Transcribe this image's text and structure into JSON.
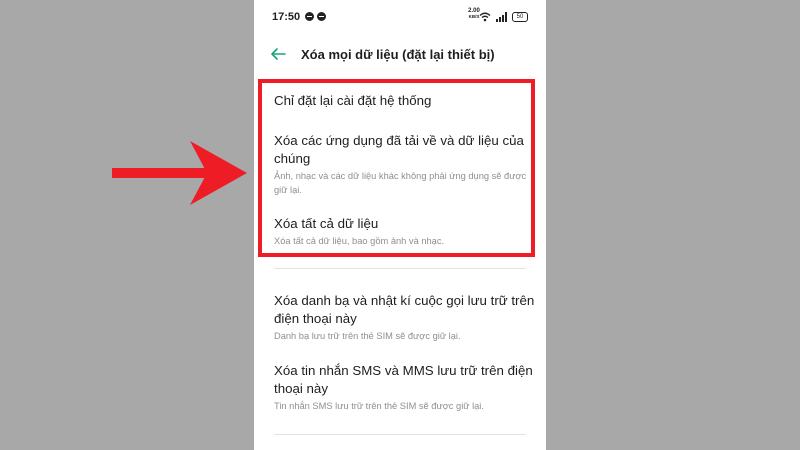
{
  "status_bar": {
    "time": "17:50",
    "net_speed": "2.00",
    "net_unit": "KB/S",
    "battery": "50",
    "icons": [
      "message-icon",
      "chat-icon",
      "wifi-icon",
      "signal-icon",
      "battery-icon"
    ]
  },
  "header": {
    "back_icon": "back-arrow-icon",
    "title": "Xóa mọi dữ liệu (đặt lại thiết bị)"
  },
  "options": [
    {
      "title": "Chỉ đặt lại cài đặt hệ thống",
      "description": ""
    },
    {
      "title": "Xóa các ứng dụng đã tải về và dữ liệu của chúng",
      "description": "Ảnh, nhạc và các dữ liệu khác không phải ứng dụng sẽ được giữ lại."
    },
    {
      "title": "Xóa tất cả dữ liệu",
      "description": "Xóa tất cả dữ liệu, bao gồm ảnh và nhạc."
    },
    {
      "title": "Xóa danh bạ và nhật kí cuộc gọi lưu trữ trên điện thoại này",
      "description": "Danh bạ lưu trữ trên thẻ SIM sẽ được giữ lại."
    },
    {
      "title": "Xóa tin nhắn SMS và MMS lưu trữ trên điện thoại này",
      "description": "Tin nhắn SMS lưu trữ trên thẻ SIM sẽ được giữ lại."
    }
  ],
  "colors": {
    "accent": "#1aa37a",
    "highlight": "#ee1c25",
    "background": "#a8a8a8"
  }
}
